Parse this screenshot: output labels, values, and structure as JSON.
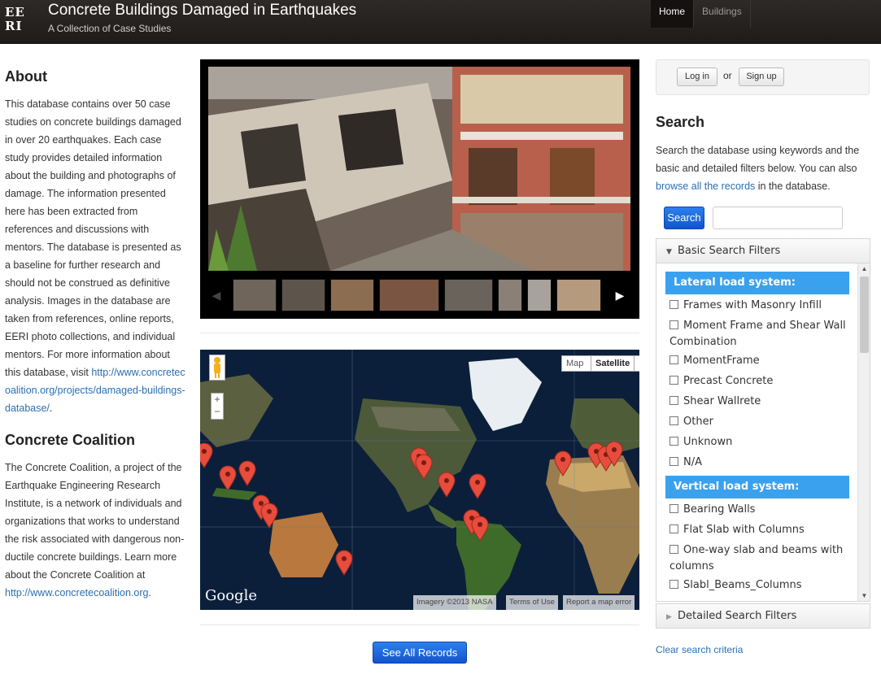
{
  "header": {
    "logo_text": "EERI",
    "title": "Concrete Buildings Damaged in Earthquakes",
    "subtitle": "A Collection of Case Studies",
    "nav": [
      {
        "label": "Home",
        "active": true
      },
      {
        "label": "Buildings",
        "active": false
      }
    ]
  },
  "about": {
    "heading": "About",
    "text": "This database contains over 50 case studies on concrete buildings damaged in over 20 earthquakes. Each case study provides detailed information about the building and photographs of damage. The information presented here has been extracted from references and discussions with mentors. The database is presented as a baseline for further research and should not be construed as definitive analysis. Images in the database are taken from references, online reports, EERI photo collections, and individual mentors. For more information about this database, visit ",
    "link": "http://www.concretecoalition.org/projects/damaged-buildings-database/",
    "link_suffix": "."
  },
  "coalition": {
    "heading": "Concrete Coalition",
    "text": "The Concrete Coalition, a project of the Earthquake Engineering Research Institute, is a network of individuals and organizations that works to understand the risk associated with dangerous non-ductile concrete buildings. Learn more about the Concrete Coalition at ",
    "link": "http://www.concretecoalition.org",
    "link_suffix": "."
  },
  "map": {
    "map_label": "Map",
    "satellite_label": "Satellite",
    "google": "Google",
    "imagery": "Imagery ©2013 NASA",
    "terms": "Terms of Use",
    "report": "Report a map error",
    "zoom_in": "+",
    "zoom_out": "−"
  },
  "see_all_label": "See All Records",
  "account": {
    "login_label": "Log in",
    "or_label": "or",
    "signup_label": "Sign up"
  },
  "search": {
    "heading": "Search",
    "desc_before": "Search the database using keywords and the basic and detailed filters below. You can also ",
    "desc_link": "browse all the records",
    "desc_after": " in the database.",
    "button_label": "Search",
    "input_value": "",
    "basic_filters_label": "Basic Search Filters",
    "detailed_filters_label": "Detailed Search Filters",
    "clear_label": "Clear search criteria",
    "lateral_heading": "Lateral load system:",
    "lateral_items": [
      "Frames with Masonry Infill",
      "Moment Frame and Shear Wall Combination",
      "MomentFrame",
      "Precast Concrete",
      "Shear Wallrete",
      "Other",
      "Unknown",
      "N/A"
    ],
    "vertical_heading": "Vertical load system:",
    "vertical_items": [
      "Bearing Walls",
      "Flat Slab with Columns",
      "One-way slab and beams with columns",
      "Slabl_Beams_Columns"
    ]
  },
  "colors": {
    "header_bg": "#231f1d",
    "accent_blue": "#1a64d9",
    "filter_heading": "#3aa1ef",
    "link": "#2a6fb2"
  }
}
